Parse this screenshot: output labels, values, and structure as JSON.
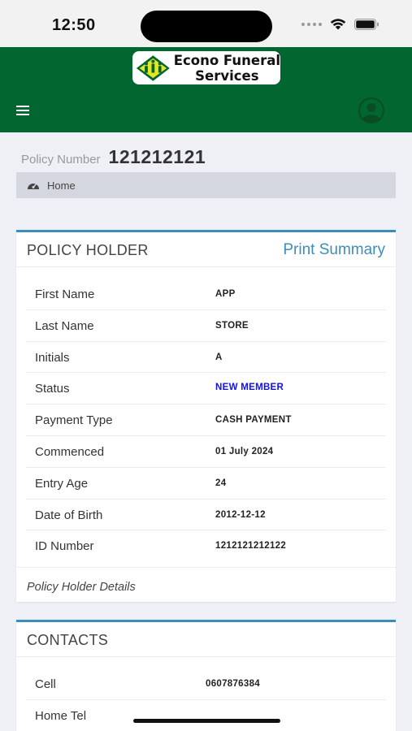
{
  "status_bar": {
    "time": "12:50"
  },
  "header": {
    "logo_line1": "Econo Funeral",
    "logo_line2": "Services",
    "brand_color": "#016630"
  },
  "policy": {
    "label": "Policy Number",
    "number": "121212121"
  },
  "breadcrumb": {
    "home": "Home"
  },
  "policy_holder": {
    "title": "POLICY HOLDER",
    "print_link": "Print Summary",
    "rows": [
      {
        "label": "First Name",
        "value": "APP"
      },
      {
        "label": "Last Name",
        "value": "STORE"
      },
      {
        "label": "Initials",
        "value": "A"
      },
      {
        "label": "Status",
        "value": "NEW MEMBER"
      },
      {
        "label": "Payment Type",
        "value": "CASH PAYMENT"
      },
      {
        "label": "Commenced",
        "value": "01 July 2024"
      },
      {
        "label": "Entry Age",
        "value": "24"
      },
      {
        "label": "Date of Birth",
        "value": "2012-12-12"
      },
      {
        "label": "ID Number",
        "value": "1212121212122"
      }
    ],
    "footer": "Policy Holder Details"
  },
  "contacts": {
    "title": "CONTACTS",
    "rows": [
      {
        "label": "Cell",
        "value": "0607876384"
      },
      {
        "label": "Home Tel",
        "value": ""
      }
    ]
  },
  "colors": {
    "accent": "#3c8dbc",
    "status_value": "#1010ee"
  }
}
